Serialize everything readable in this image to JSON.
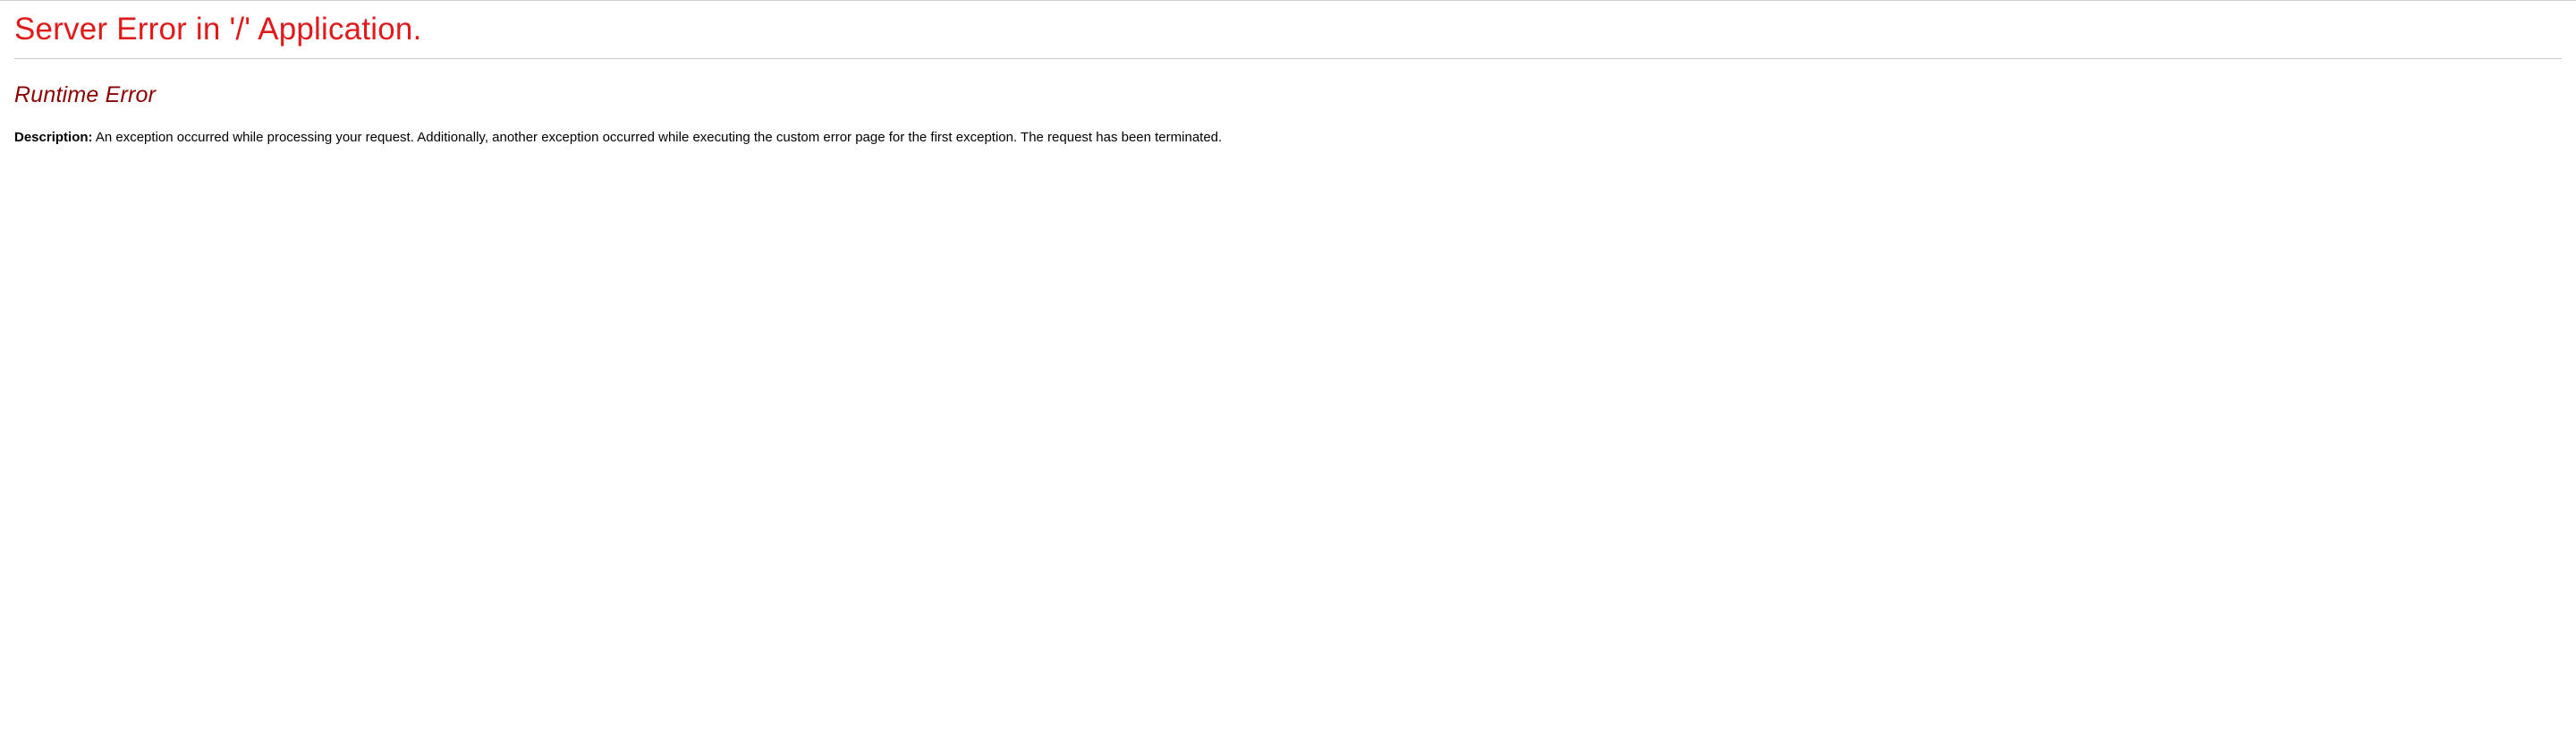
{
  "error": {
    "title": "Server Error in '/' Application.",
    "subtitle": "Runtime Error",
    "description_label": "Description:",
    "description_text": "An exception occurred while processing your request. Additionally, another exception occurred while executing the custom error page for the first exception. The request has been terminated."
  }
}
